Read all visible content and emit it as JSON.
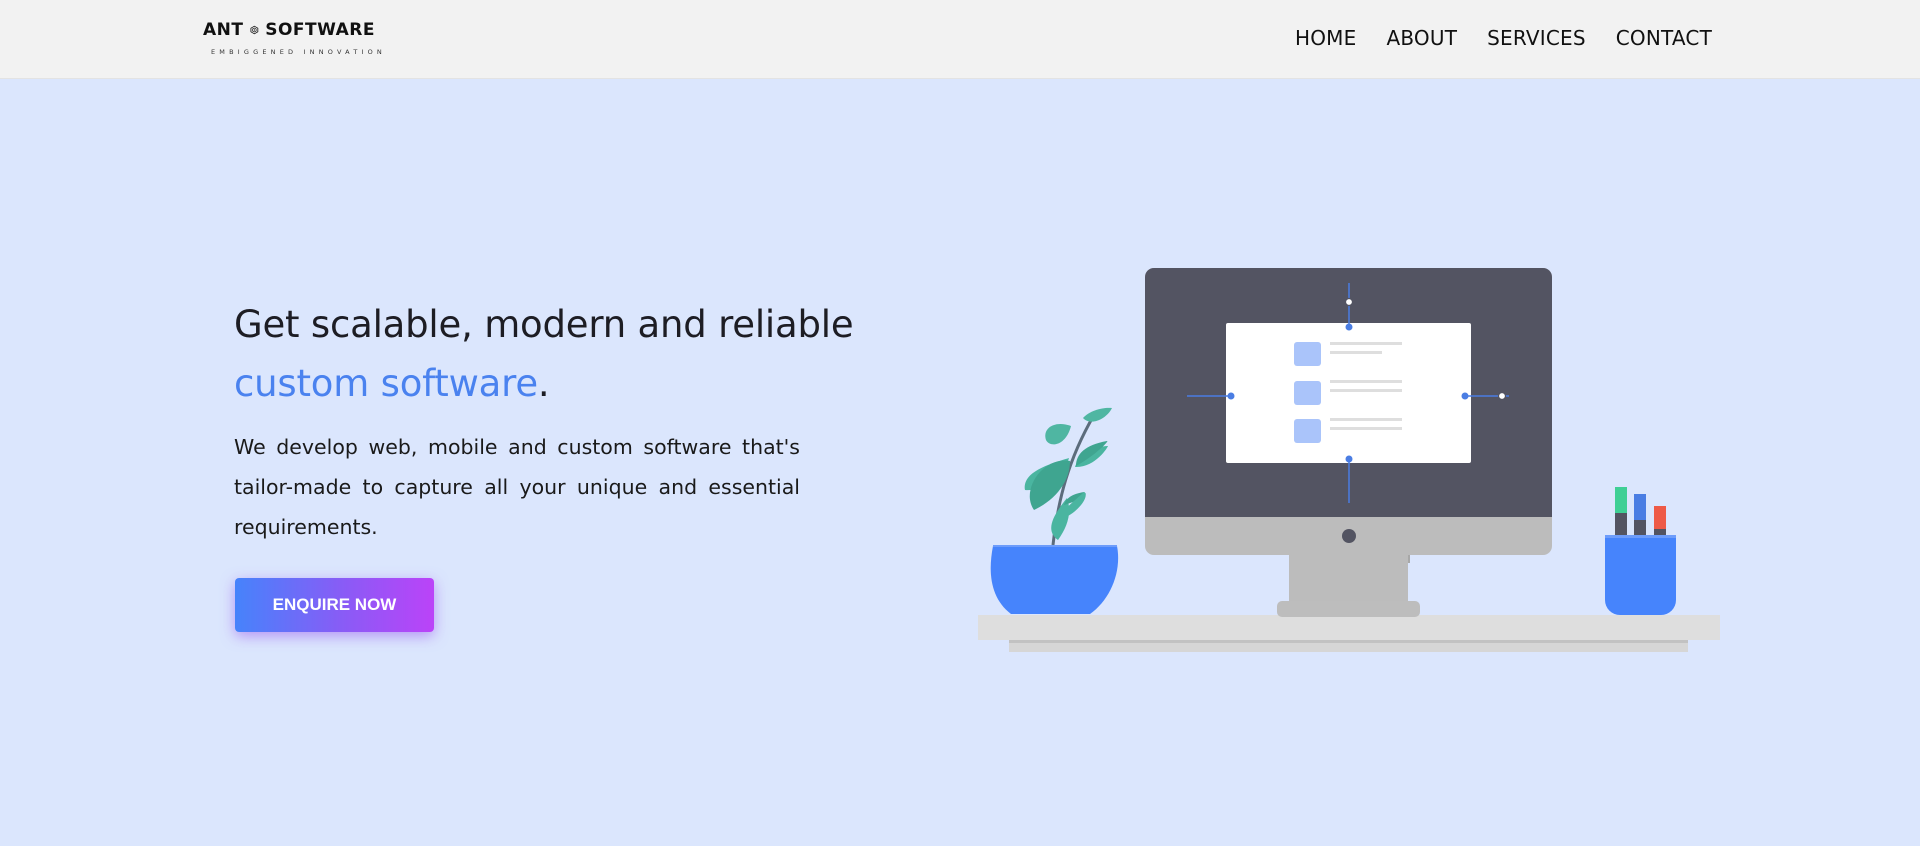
{
  "header": {
    "logo": {
      "name_left": "ANT",
      "name_right": "SOFTWARE",
      "tagline": "EMBIGGENED INNOVATION",
      "icon": "hexagon-logo-icon"
    },
    "nav": [
      "HOME",
      "ABOUT",
      "SERVICES",
      "CONTACT"
    ]
  },
  "hero": {
    "title_line1": "Get scalable, modern and reliable",
    "title_accent": "custom software",
    "title_end": ".",
    "description": "We develop web, mobile and custom software that's tailor-made to capture all your unique and essential requirements.",
    "cta_label": "ENQUIRE NOW"
  },
  "illustration": {
    "icons": [
      "desk-icon",
      "monitor-icon",
      "plant-icon",
      "pen-cup-icon"
    ]
  },
  "colors": {
    "background": "#dbe6fd",
    "header_bg": "#f2f2f2",
    "accent": "#4a82ef",
    "cta_gradient_start": "#4683fb",
    "cta_gradient_end": "#bb43f8",
    "monitor_screen": "#535462",
    "pot_blue": "#4684fc",
    "leaf_green": "#4ab5a0"
  }
}
